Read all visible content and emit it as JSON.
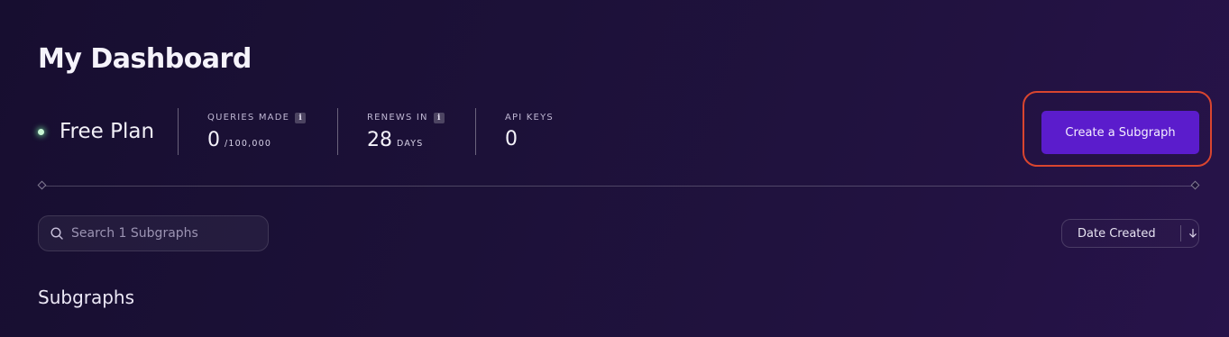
{
  "header": {
    "title": "My Dashboard"
  },
  "plan": {
    "label": "Free Plan",
    "status_color": "#8df2ac"
  },
  "stats": {
    "queries": {
      "label": "QUERIES MADE",
      "value": "0",
      "unit": "/100,000"
    },
    "renews": {
      "label": "RENEWS IN",
      "value": "28",
      "unit": "DAYS"
    },
    "api_keys": {
      "label": "API KEYS",
      "value": "0"
    }
  },
  "actions": {
    "create_label": "Create a Subgraph",
    "accent": "#5b1ccc",
    "highlight": "#d9452f"
  },
  "search": {
    "placeholder": "Search 1 Subgraphs",
    "value": ""
  },
  "sort": {
    "label": "Date Created"
  },
  "section": {
    "title": "Subgraphs"
  },
  "icons": {
    "info": "info-icon",
    "search": "search-icon",
    "sort": "arrow-down-icon"
  }
}
